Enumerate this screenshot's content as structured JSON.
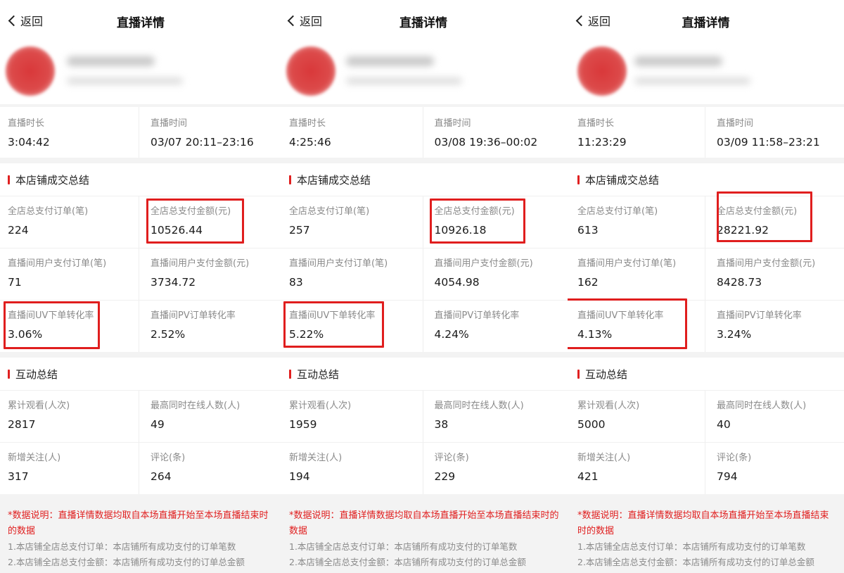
{
  "nav": {
    "back_label": "返回",
    "title": "直播详情"
  },
  "labels": {
    "duration": "直播时长",
    "time": "直播时间",
    "section_sales": "本店铺成交总结",
    "total_orders": "全店总支付订单(笔)",
    "total_amount": "全店总支付金额(元)",
    "live_orders": "直播间用户支付订单(笔)",
    "live_amount": "直播间用户支付金额(元)",
    "uv_rate": "直播间UV下单转化率",
    "pv_rate": "直播间PV订单转化率",
    "section_interact": "互动总结",
    "views": "累计观看(人次)",
    "peak_online": "最高同时在线人数(人)",
    "new_follows": "新增关注(人)",
    "comments": "评论(条)"
  },
  "notes": {
    "red": "*数据说明：直播详情数据均取自本场直播开始至本场直播结束时的数据",
    "item1": "1.本店铺全店总支付订单：本店铺所有成功支付的订单笔数",
    "item2": "2.本店铺全店总支付金额：本店铺所有成功支付的订单总金额"
  },
  "highlight_color": "#e01e1e",
  "panels": [
    {
      "duration": "3:04:42",
      "time": "03/07 20:11–23:16",
      "total_orders": "224",
      "total_amount": "10526.44",
      "live_orders": "71",
      "live_amount": "3734.72",
      "uv_rate": "3.06%",
      "pv_rate": "2.52%",
      "views": "2817",
      "peak_online": "49",
      "new_follows": "317",
      "comments": "264"
    },
    {
      "duration": "4:25:46",
      "time": "03/08 19:36–00:02",
      "total_orders": "257",
      "total_amount": "10926.18",
      "live_orders": "83",
      "live_amount": "4054.98",
      "uv_rate": "5.22%",
      "pv_rate": "4.24%",
      "views": "1959",
      "peak_online": "38",
      "new_follows": "194",
      "comments": "229"
    },
    {
      "duration": "11:23:29",
      "time": "03/09 11:58–23:21",
      "total_orders": "613",
      "total_amount": "28221.92",
      "live_orders": "162",
      "live_amount": "8428.73",
      "uv_rate": "4.13%",
      "pv_rate": "3.24%",
      "views": "5000",
      "peak_online": "40",
      "new_follows": "421",
      "comments": "794"
    }
  ]
}
